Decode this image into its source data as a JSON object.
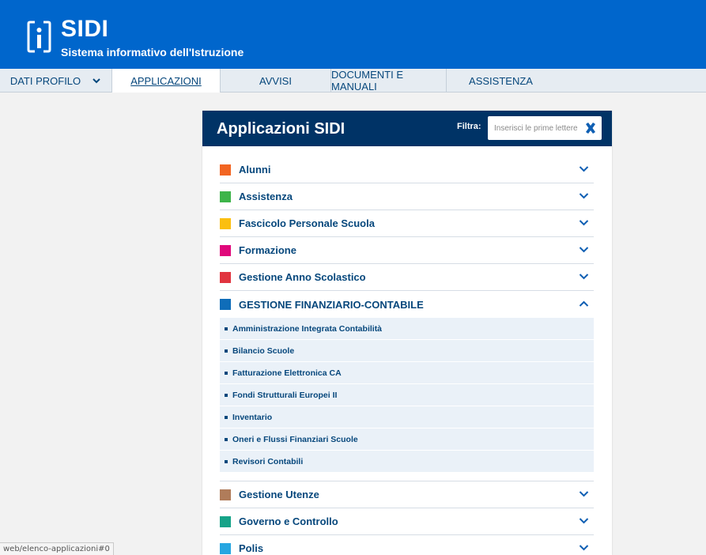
{
  "header": {
    "brand_name": "SIDI",
    "brand_subtitle": "Sistema informativo dell'Istruzione",
    "bg_color": "#0066cc"
  },
  "nav": {
    "items": [
      {
        "label": "DATI PROFILO",
        "has_dropdown": true
      },
      {
        "label": "APPLICAZIONI",
        "active": true
      },
      {
        "label": "AVVISI"
      },
      {
        "label": "DOCUMENTI E MANUALI"
      },
      {
        "label": "ASSISTENZA"
      }
    ]
  },
  "panel": {
    "title": "Applicazioni SIDI",
    "filter_label": "Filtra:",
    "filter_placeholder": "Inserisci le prime lettere",
    "filter_value": "",
    "categories": [
      {
        "label": "Alunni",
        "color": "#f26522",
        "expanded": false
      },
      {
        "label": "Assistenza",
        "color": "#3db44a",
        "expanded": false
      },
      {
        "label": "Fascicolo Personale Scuola",
        "color": "#fbbf10",
        "expanded": false
      },
      {
        "label": "Formazione",
        "color": "#e0087b",
        "expanded": false
      },
      {
        "label": "Gestione Anno Scolastico",
        "color": "#e1343f",
        "expanded": false
      },
      {
        "label": "GESTIONE FINANZIARIO-CONTABILE",
        "color": "#0f6db9",
        "expanded": true,
        "items": [
          "Amministrazione Integrata Contabilità",
          "Bilancio Scuole",
          "Fatturazione Elettronica CA",
          "Fondi Strutturali Europei II",
          "Inventario",
          "Oneri e Flussi Finanziari Scuole",
          "Revisori Contabili"
        ]
      },
      {
        "label": "Gestione Utenze",
        "color": "#b07c5a",
        "expanded": false
      },
      {
        "label": "Governo e Controllo",
        "color": "#16a388",
        "expanded": false
      },
      {
        "label": "Polis",
        "color": "#27a6e1",
        "expanded": false
      }
    ]
  },
  "status_bar": {
    "url": "web/elenco-applicazioni#0"
  }
}
